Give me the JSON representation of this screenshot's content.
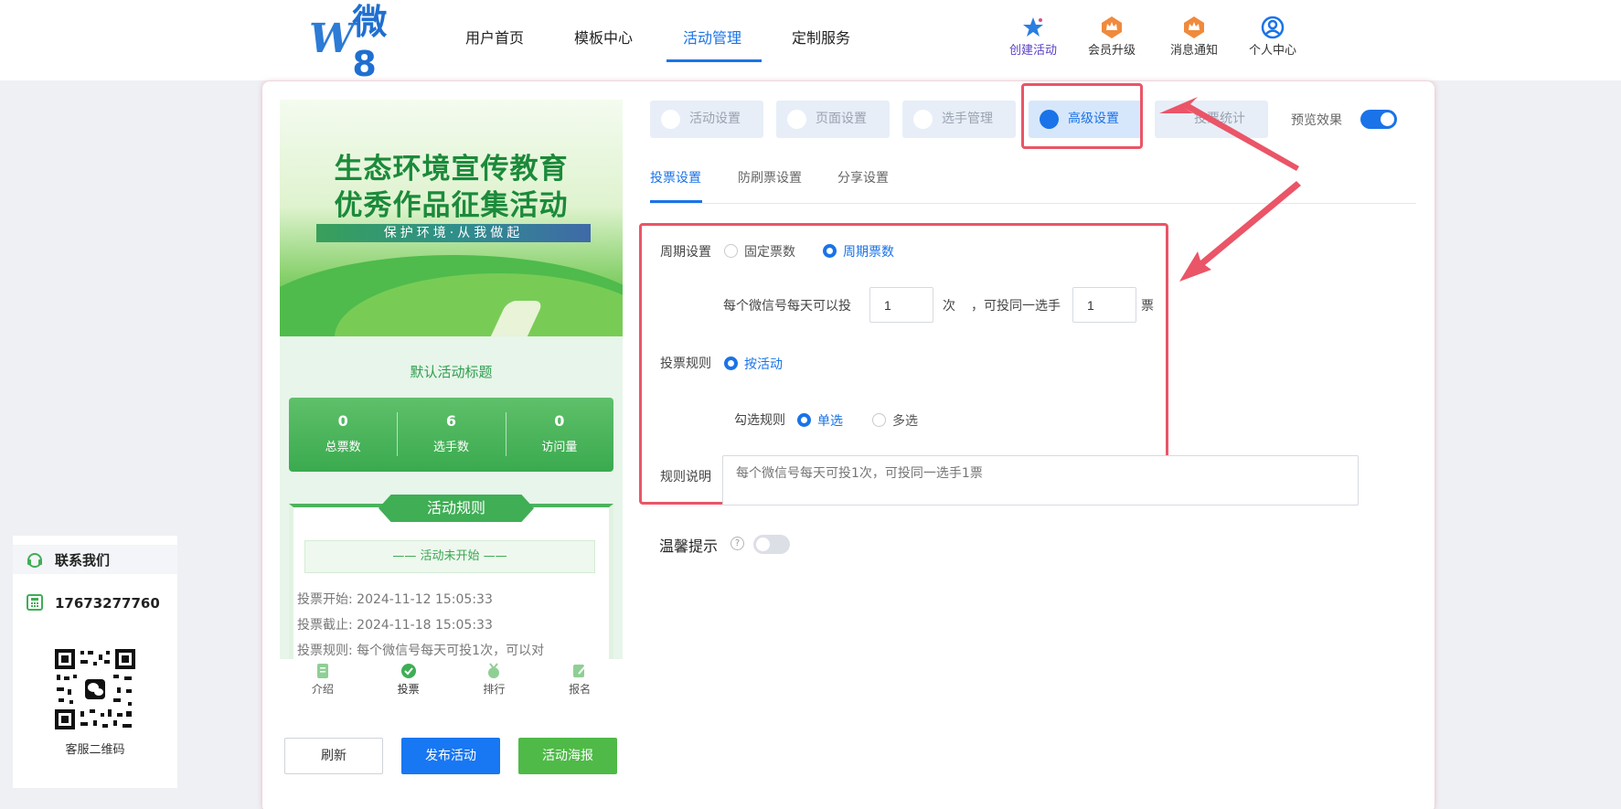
{
  "header": {
    "logo_letter": "W",
    "logo_text": "微8",
    "nav": [
      "用户首页",
      "模板中心",
      "活动管理",
      "定制服务"
    ],
    "tools": {
      "create": "创建活动",
      "upgrade": "会员升级",
      "notify": "消息通知",
      "profile": "个人中心"
    }
  },
  "preview": {
    "banner_title1": "生态环境宣传教育",
    "banner_title2": "优秀作品征集活动",
    "banner_slogan": "保护环境·从我做起",
    "activity_title": "默认活动标题",
    "stats": [
      {
        "num": "0",
        "label": "总票数"
      },
      {
        "num": "6",
        "label": "选手数"
      },
      {
        "num": "0",
        "label": "访问量"
      }
    ],
    "rules_heading": "活动规则",
    "not_started": "—— 活动未开始 ——",
    "vote_start": "投票开始:  2024-11-12 15:05:33",
    "vote_end": "投票截止:  2024-11-18 15:05:33",
    "vote_rule": "投票规则:  每个微信号每天可投1次，可以对",
    "tabs": [
      "介绍",
      "投票",
      "排行",
      "报名"
    ]
  },
  "buttons": {
    "refresh": "刷新",
    "publish": "发布活动",
    "poster": "活动海报"
  },
  "settings_tabs": [
    "活动设置",
    "页面设置",
    "选手管理",
    "高级设置",
    "投票统计"
  ],
  "preview_toggle_label": "预览效果",
  "sub_tabs": [
    "投票设置",
    "防刷票设置",
    "分享设置"
  ],
  "form": {
    "period_label": "周期设置",
    "fixed_votes": "固定票数",
    "period_votes": "周期票数",
    "per_day_text": "每个微信号每天可以投",
    "times_value": "1",
    "times_unit": "次",
    "same_player_text": "，可投同一选手",
    "votes_value": "1",
    "votes_unit": "票",
    "rule_label": "投票规则",
    "by_activity": "按活动",
    "select_rule_label": "勾选规则",
    "single": "单选",
    "multi": "多选",
    "desc_label": "规则说明",
    "desc_placeholder": "每个微信号每天可投1次，可投同一选手1票"
  },
  "tips_label": "温馨提示",
  "contact": {
    "title": "联系我们",
    "phone": "17673277760",
    "qr_label": "客服二维码"
  },
  "colors": {
    "accent": "#1a73e8",
    "highlight": "#ea5567",
    "green": "#3fae55"
  }
}
